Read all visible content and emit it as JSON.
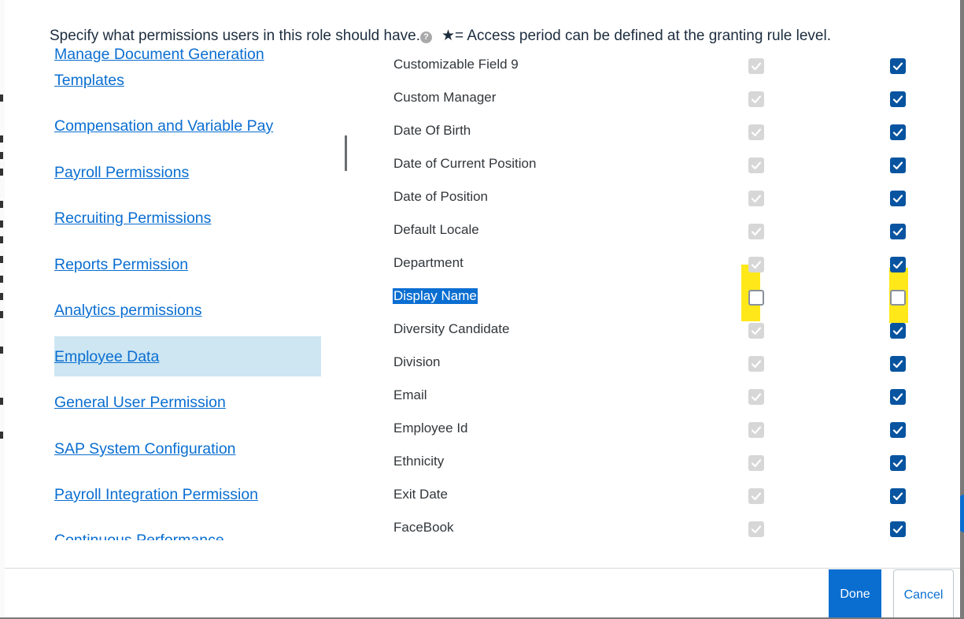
{
  "header": {
    "instruction": "Specify what permissions users in this role should have.",
    "help_icon_glyph": "?",
    "access_note": "★= Access period can be defined at the granting rule level."
  },
  "nav": {
    "items": [
      {
        "label": "Manage Document Generation"
      },
      {
        "label": "Templates"
      },
      {
        "label": "Compensation and Variable Pay"
      },
      {
        "label": "Payroll Permissions"
      },
      {
        "label": "Recruiting Permissions"
      },
      {
        "label": "Reports Permission"
      },
      {
        "label": "Analytics permissions"
      },
      {
        "label": "Employee Data",
        "selected": true
      },
      {
        "label": "General User Permission"
      },
      {
        "label": "SAP System Configuration"
      },
      {
        "label": "Payroll Integration Permission"
      },
      {
        "label": "Continuous Performance"
      }
    ]
  },
  "fields": {
    "rows": [
      {
        "label": "Customizable Field 9",
        "col1": "checked-disabled",
        "col2": "checked"
      },
      {
        "label": "Custom Manager",
        "col1": "checked-disabled",
        "col2": "checked"
      },
      {
        "label": "Date Of Birth",
        "col1": "checked-disabled",
        "col2": "checked"
      },
      {
        "label": "Date of Current Position",
        "col1": "checked-disabled",
        "col2": "checked"
      },
      {
        "label": "Date of Position",
        "col1": "checked-disabled",
        "col2": "checked"
      },
      {
        "label": "Default Locale",
        "col1": "checked-disabled",
        "col2": "checked"
      },
      {
        "label": "Department",
        "col1": "checked-disabled",
        "col2": "checked"
      },
      {
        "label": "Display Name",
        "col1": "unchecked",
        "col2": "unchecked",
        "selected": true,
        "highlighted": true
      },
      {
        "label": "Diversity Candidate",
        "col1": "checked-disabled",
        "col2": "checked"
      },
      {
        "label": "Division",
        "col1": "checked-disabled",
        "col2": "checked"
      },
      {
        "label": "Email",
        "col1": "checked-disabled",
        "col2": "checked"
      },
      {
        "label": "Employee Id",
        "col1": "checked-disabled",
        "col2": "checked"
      },
      {
        "label": "Ethnicity",
        "col1": "checked-disabled",
        "col2": "checked"
      },
      {
        "label": "Exit Date",
        "col1": "checked-disabled",
        "col2": "checked"
      },
      {
        "label": "FaceBook",
        "col1": "checked-disabled",
        "col2": "checked"
      }
    ]
  },
  "footer": {
    "done_label": "Done",
    "cancel_label": "Cancel"
  },
  "colors": {
    "accent": "#0a6ed1",
    "checkbox_checked": "#0854a0",
    "checkbox_disabled": "#d7d7d7",
    "highlight": "#ffe500",
    "selected_nav_bg": "#cde6f2"
  }
}
